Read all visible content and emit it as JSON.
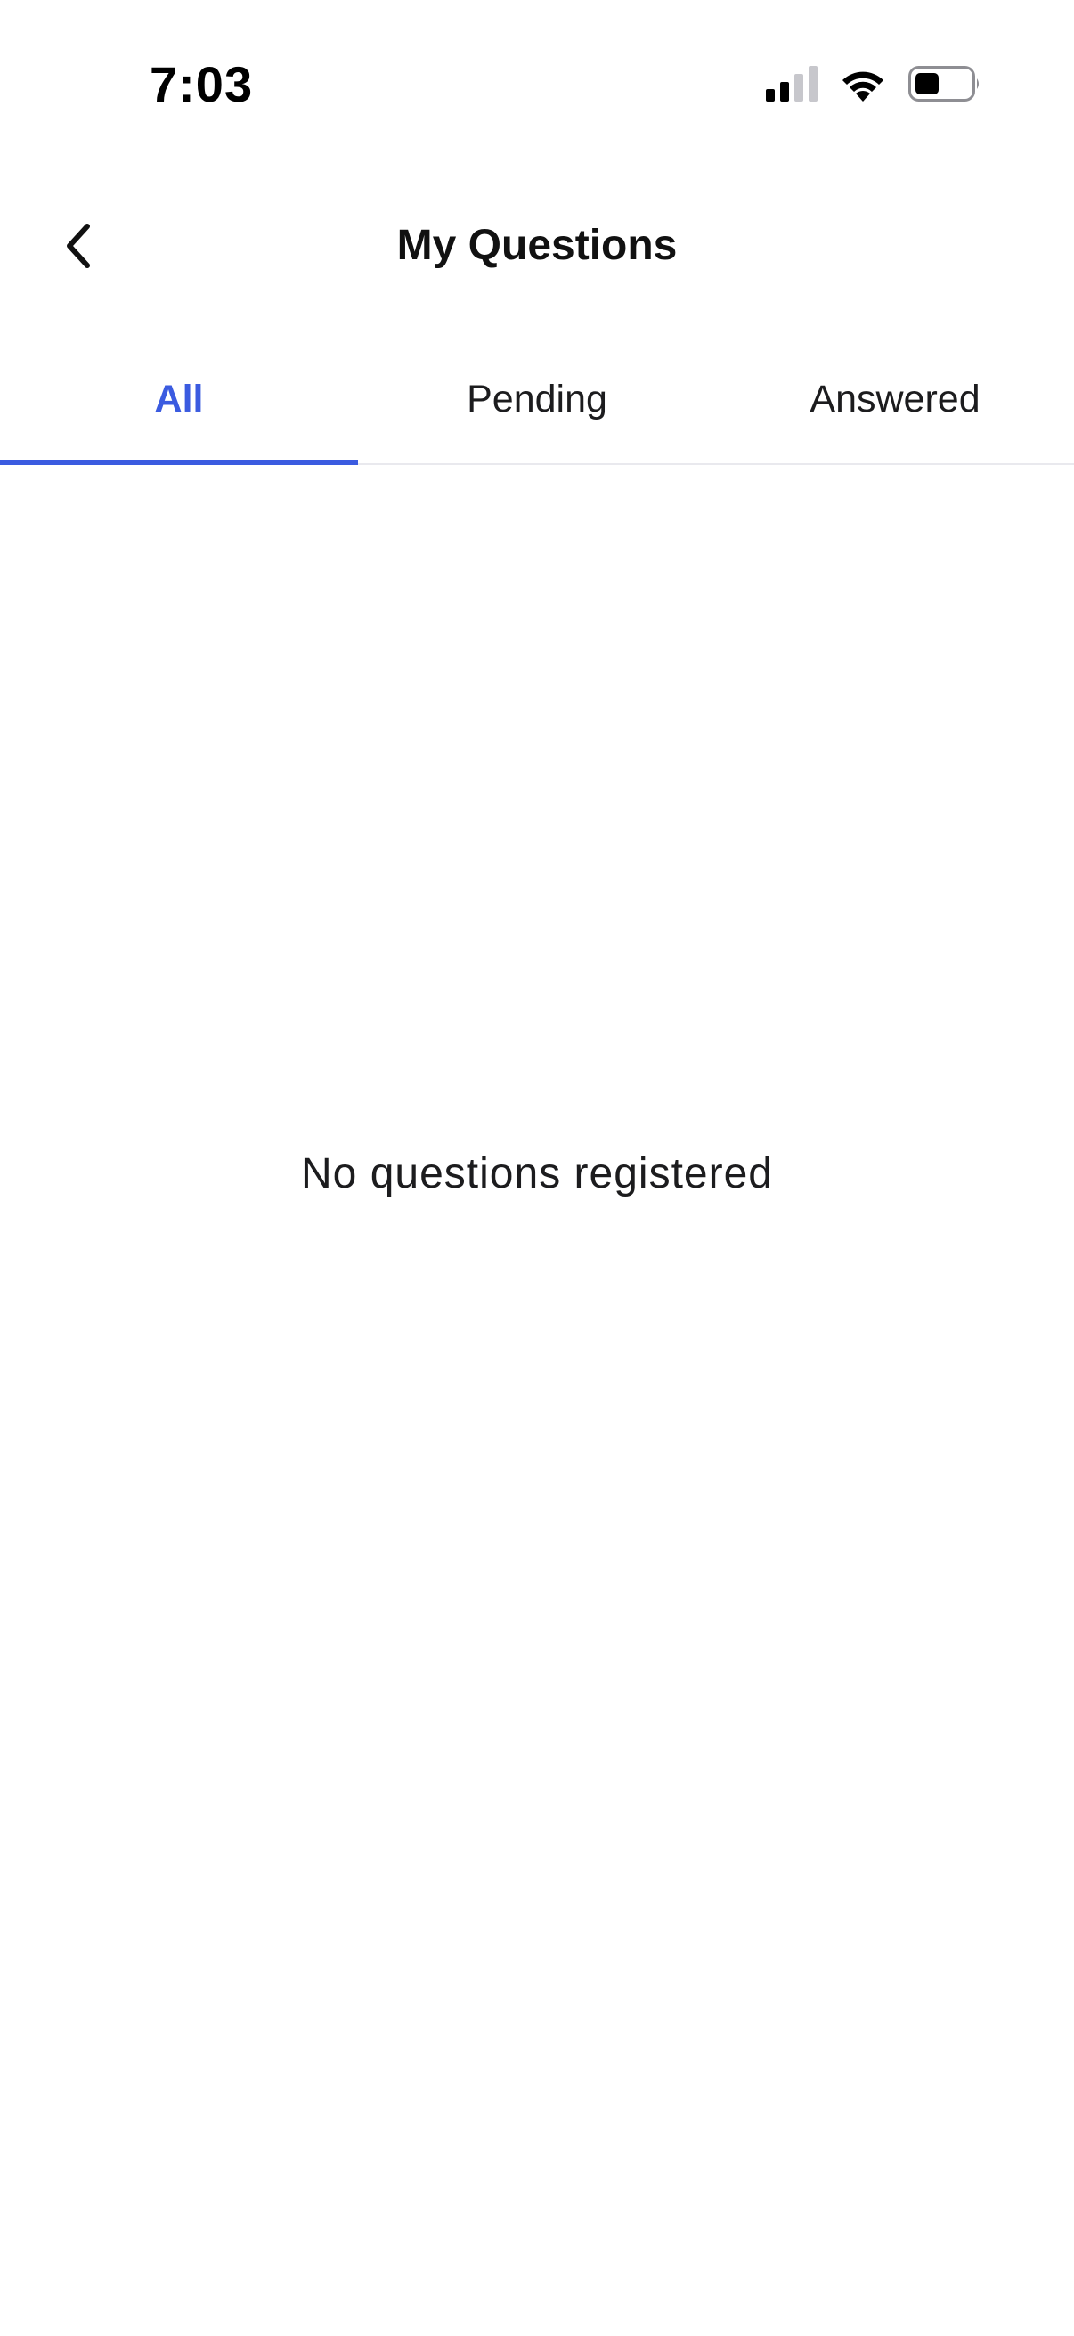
{
  "status_bar": {
    "time": "7:03",
    "icons": [
      "signal-icon",
      "wifi-icon",
      "battery-icon"
    ]
  },
  "header": {
    "back_icon": "chevron-left-icon",
    "title": "My Questions"
  },
  "tabs": [
    {
      "label": "All",
      "active": true
    },
    {
      "label": "Pending",
      "active": false
    },
    {
      "label": "Answered",
      "active": false
    }
  ],
  "main": {
    "empty_message": "No questions registered"
  },
  "colors": {
    "accent": "#3b5be0",
    "text": "#111111",
    "divider": "#e9e9ee"
  }
}
